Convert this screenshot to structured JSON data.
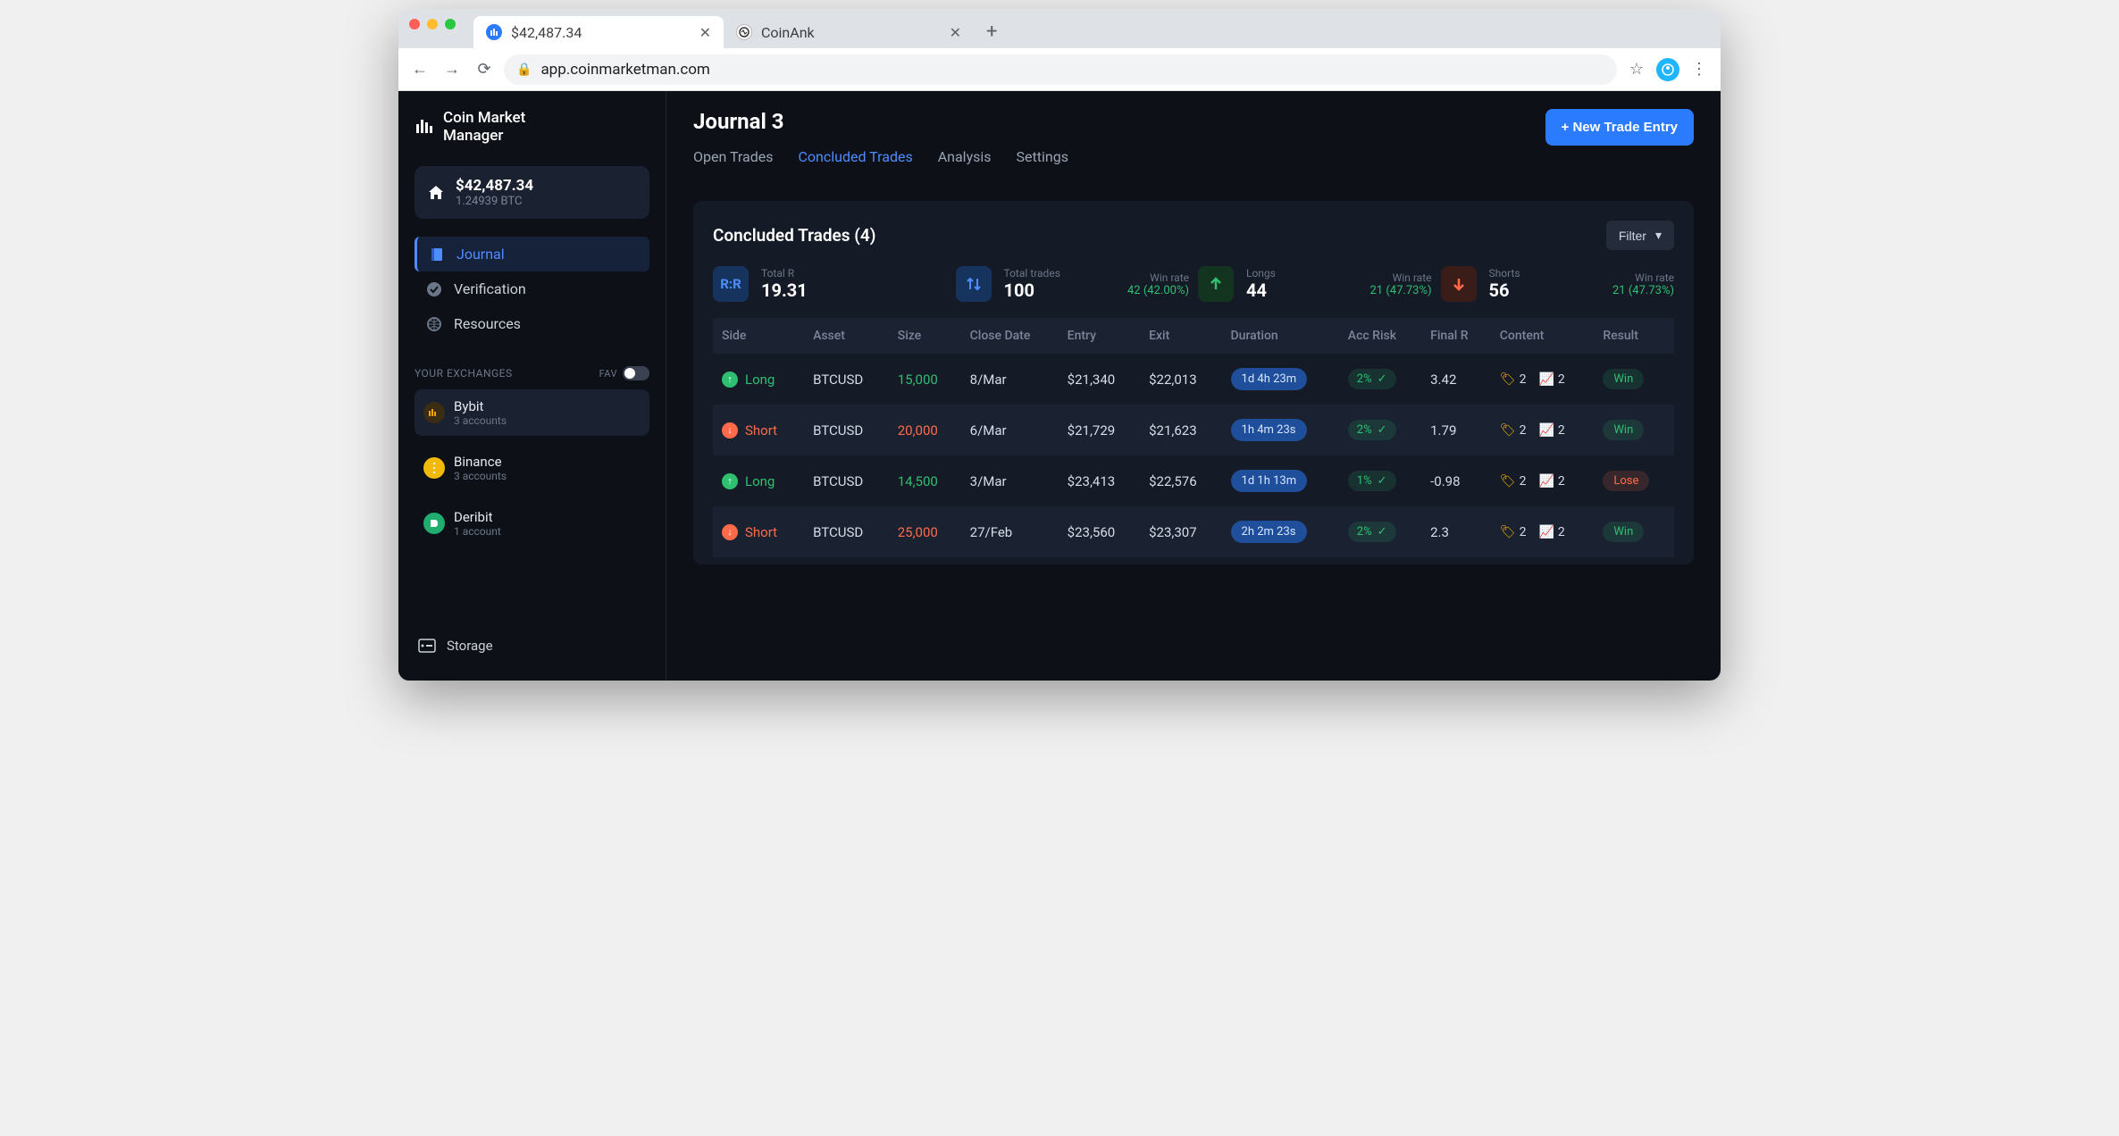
{
  "browser": {
    "tabs": [
      {
        "title": "$42,487.34",
        "favicon_bg": "#2b7bff"
      },
      {
        "title": "CoinAnk",
        "favicon_bg": "#ffffff"
      }
    ],
    "url": "app.coinmarketman.com"
  },
  "brand": {
    "line1": "Coin Market",
    "line2": "Manager"
  },
  "balance": {
    "usd": "$42,487.34",
    "btc": "1.24939 BTC"
  },
  "nav": {
    "journal": "Journal",
    "verification": "Verification",
    "resources": "Resources",
    "storage": "Storage"
  },
  "exchanges": {
    "section_label": "YOUR EXCHANGES",
    "fav_label": "FAV",
    "items": [
      {
        "name": "Bybit",
        "sub": "3 accounts",
        "color": "#3a2d14"
      },
      {
        "name": "Binance",
        "sub": "3 accounts",
        "color": "#f0b90b"
      },
      {
        "name": "Deribit",
        "sub": "1 account",
        "color": "#1fae70"
      }
    ]
  },
  "page": {
    "title": "Journal 3",
    "new_entry": "+ New Trade Entry",
    "tabs": {
      "open": "Open Trades",
      "concluded": "Concluded Trades",
      "analysis": "Analysis",
      "settings": "Settings"
    }
  },
  "panel": {
    "title": "Concluded Trades (4)",
    "filter": "Filter",
    "stats": {
      "total_r": {
        "label": "Total R",
        "value": "19.31"
      },
      "total_trades": {
        "label": "Total trades",
        "value": "100",
        "rate_label": "Win rate",
        "rate": "42 (42.00%)"
      },
      "longs": {
        "label": "Longs",
        "value": "44",
        "rate_label": "Win rate",
        "rate": "21 (47.73%)"
      },
      "shorts": {
        "label": "Shorts",
        "value": "56",
        "rate_label": "Win rate",
        "rate": "21 (47.73%)"
      }
    },
    "columns": {
      "side": "Side",
      "asset": "Asset",
      "size": "Size",
      "close": "Close Date",
      "entry": "Entry",
      "exit": "Exit",
      "duration": "Duration",
      "risk": "Acc Risk",
      "finalr": "Final R",
      "content": "Content",
      "result": "Result"
    },
    "rows": [
      {
        "side": "Long",
        "asset": "BTCUSD",
        "size": "15,000",
        "close": "8/Mar",
        "entry": "$21,340",
        "exit": "$22,013",
        "duration": "1d 4h 23m",
        "risk": "2%",
        "finalr": "3.42",
        "tag_count": "2",
        "chart_count": "2",
        "result": "Win"
      },
      {
        "side": "Short",
        "asset": "BTCUSD",
        "size": "20,000",
        "close": "6/Mar",
        "entry": "$21,729",
        "exit": "$21,623",
        "duration": "1h 4m 23s",
        "risk": "2%",
        "finalr": "1.79",
        "tag_count": "2",
        "chart_count": "2",
        "result": "Win"
      },
      {
        "side": "Long",
        "asset": "BTCUSD",
        "size": "14,500",
        "close": "3/Mar",
        "entry": "$23,413",
        "exit": "$22,576",
        "duration": "1d 1h 13m",
        "risk": "1%",
        "finalr": "-0.98",
        "tag_count": "2",
        "chart_count": "2",
        "result": "Lose"
      },
      {
        "side": "Short",
        "asset": "BTCUSD",
        "size": "25,000",
        "close": "27/Feb",
        "entry": "$23,560",
        "exit": "$23,307",
        "duration": "2h 2m 23s",
        "risk": "2%",
        "finalr": "2.3",
        "tag_count": "2",
        "chart_count": "2",
        "result": "Win"
      }
    ]
  }
}
